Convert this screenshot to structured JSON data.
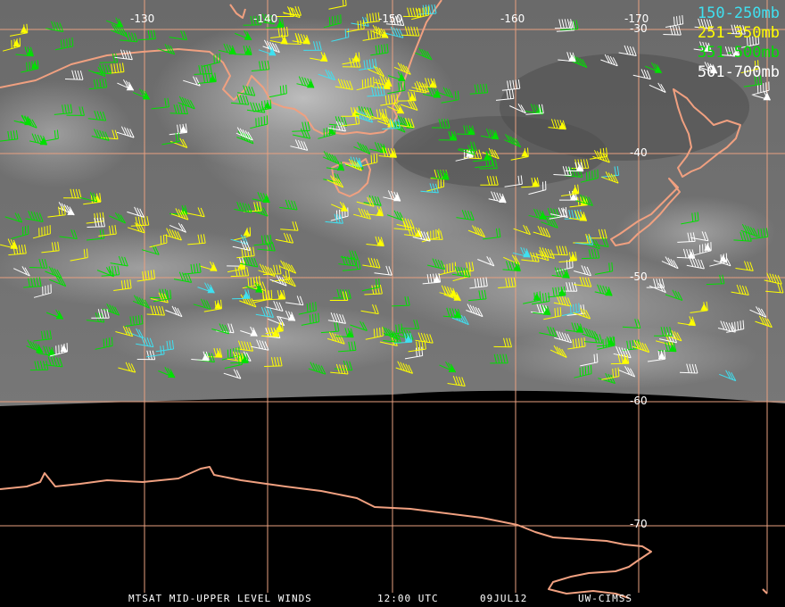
{
  "legend": {
    "items": [
      {
        "label": "150-250mb",
        "color": "#3fe0f0"
      },
      {
        "label": "251-350mb",
        "color": "#ffff00"
      },
      {
        "label": "351-500mb",
        "color": "#00e000"
      },
      {
        "label": "501-700mb",
        "color": "#ffffff"
      }
    ]
  },
  "grid": {
    "longitudes": [
      "-130",
      "-140",
      "-150",
      "-160",
      "-170"
    ],
    "latitudes": [
      "-30",
      "-40",
      "-50",
      "-60",
      "-70"
    ],
    "line_color": "#e8a080"
  },
  "footer": {
    "product": "MTSAT MID-UPPER LEVEL WINDS",
    "time": "12:00 UTC",
    "date": "09JUL12",
    "source": "UW-CIMSS"
  },
  "colors": {
    "coastline": "#f0a080",
    "background_night": "#000000"
  }
}
